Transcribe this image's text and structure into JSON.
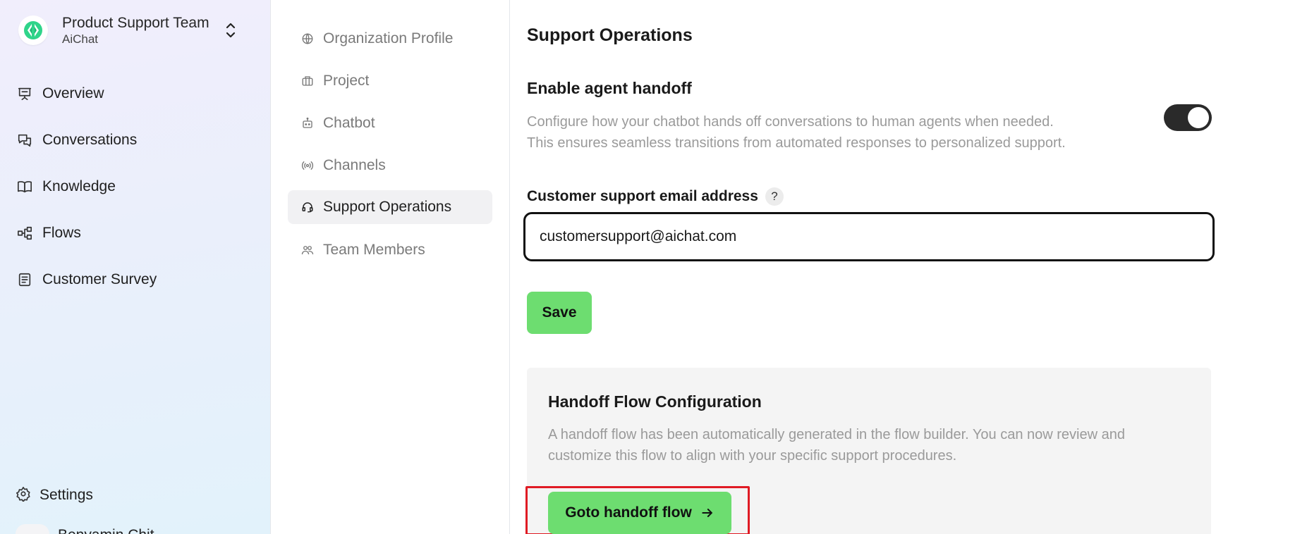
{
  "sidebar": {
    "team": {
      "name": "Product Support Team",
      "subtitle": "AiChat",
      "logo_icon": "aichat-logo-icon",
      "switch_icon": "chevron-up-down-icon"
    },
    "items": [
      {
        "label": "Overview",
        "icon": "presentation-icon"
      },
      {
        "label": "Conversations",
        "icon": "chat-bubbles-icon"
      },
      {
        "label": "Knowledge",
        "icon": "book-icon"
      },
      {
        "label": "Flows",
        "icon": "flow-nodes-icon"
      },
      {
        "label": "Customer Survey",
        "icon": "clipboard-icon"
      }
    ],
    "settings": {
      "label": "Settings",
      "icon": "gear-icon"
    },
    "user": {
      "label": "Benyamin Chit"
    }
  },
  "settings_nav": {
    "items": [
      {
        "label": "Organization Profile",
        "icon": "globe-icon",
        "active": false
      },
      {
        "label": "Project",
        "icon": "briefcase-icon",
        "active": false
      },
      {
        "label": "Chatbot",
        "icon": "bot-icon",
        "active": false
      },
      {
        "label": "Channels",
        "icon": "broadcast-icon",
        "active": false
      },
      {
        "label": "Support Operations",
        "icon": "headset-icon",
        "active": true
      },
      {
        "label": "Team Members",
        "icon": "users-icon",
        "active": false
      }
    ]
  },
  "main": {
    "title": "Support Operations",
    "handoff": {
      "title": "Enable agent handoff",
      "description_line1": "Configure how your chatbot hands off conversations to human agents when needed.",
      "description_line2": "This ensures seamless transitions from automated responses to personalized support.",
      "enabled": true
    },
    "email": {
      "label": "Customer support email address",
      "help_symbol": "?",
      "value": "customersupport@aichat.com"
    },
    "save_label": "Save",
    "flow_card": {
      "title": "Handoff Flow Configuration",
      "description": "A handoff flow has been automatically generated in the flow builder. You can now review and customize this flow to align with your specific support procedures.",
      "button_label": "Goto handoff flow",
      "button_icon": "arrow-right-icon"
    }
  },
  "colors": {
    "accent_green": "#6ddd70",
    "toggle_on": "#2a2a2a",
    "highlight_red": "#e01b24",
    "logo_green": "#2fd48a"
  }
}
